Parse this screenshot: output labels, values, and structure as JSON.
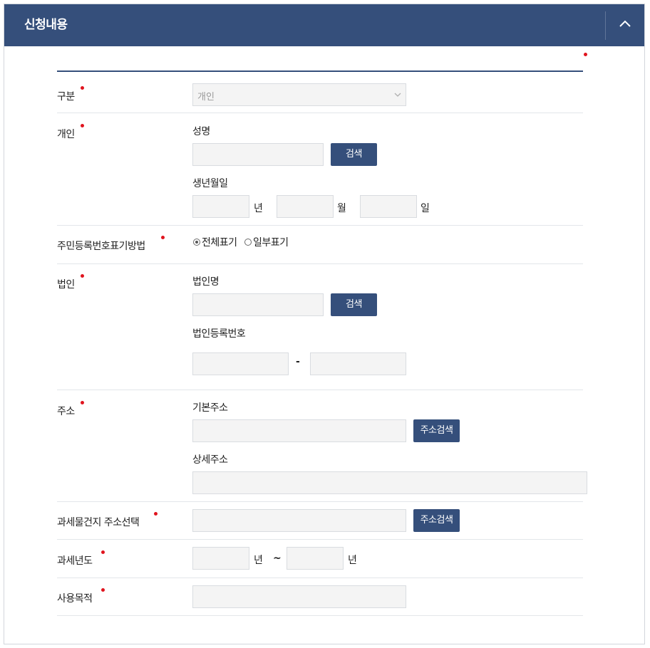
{
  "header": {
    "title": "신청내용",
    "toggle_icon": "chevron-up-icon"
  },
  "colors": {
    "header_bg": "#354f7b",
    "required_dot": "#e0141e",
    "field_bg": "#f4f4f4"
  },
  "form": {
    "category": {
      "label": "구분",
      "value": "개인"
    },
    "individual": {
      "label": "개인",
      "name_label": "성명",
      "search_button": "검색",
      "birth_label": "생년월일",
      "year_unit": "년",
      "month_unit": "월",
      "day_unit": "일"
    },
    "id_display": {
      "label": "주민등록번호표기방법",
      "options": [
        "전체표기",
        "일부표기"
      ],
      "selected": "전체표기"
    },
    "corporation": {
      "label": "법인",
      "name_label": "법인명",
      "search_button": "검색",
      "reg_label": "법인등록번호",
      "separator": "-"
    },
    "address": {
      "label": "주소",
      "basic_label": "기본주소",
      "search_button": "주소검색",
      "detail_label": "상세주소"
    },
    "tax_address": {
      "label": "과세물건지 주소선택",
      "search_button": "주소검색"
    },
    "tax_year": {
      "label": "과세년도",
      "unit_from": "년",
      "tilde": "~",
      "unit_to": "년"
    },
    "purpose": {
      "label": "사용목적"
    }
  }
}
